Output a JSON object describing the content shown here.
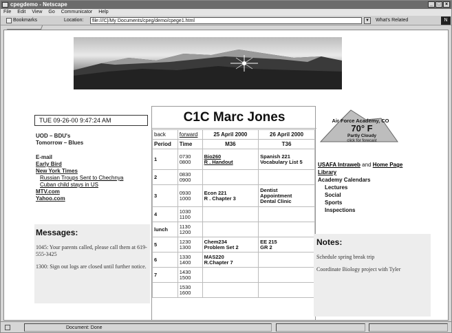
{
  "window": {
    "title": "cpegdemo - Netscape"
  },
  "menu": [
    "File",
    "Edit",
    "View",
    "Go",
    "Communicator",
    "Help"
  ],
  "toolbar": {
    "bookmarks": "Bookmarks",
    "location_label": "Location:",
    "location_value": "file:///C|/My Documents/cpeg/demo/cpege1.html",
    "related": "What's Related",
    "brand_glyph": "N"
  },
  "clock": {
    "text": "TUE   09-26-00   9:47:24 AM"
  },
  "left": {
    "uod": "UOD – BDU's",
    "tomorrow": "Tomorrow – Blues",
    "email": "E-mail",
    "links": [
      "Early Bird",
      "New York Times"
    ],
    "news": [
      "Russian Troups Sent to Chechnya",
      "Cuban child stays in US"
    ],
    "links2": [
      "MTV.com",
      "Yahoo.com"
    ]
  },
  "messages": {
    "heading": "Messages:",
    "items": [
      "1045: Your parents called, please call them at 619-555-3425",
      "1300: Sign out logs are closed until further notice."
    ]
  },
  "schedule": {
    "name": "C1C Marc Jones",
    "back": "back",
    "forward": "forward",
    "date1": "25 April 2000",
    "date2": "26 April 2000",
    "period_label": "Period",
    "time_label": "Time",
    "day1": "M36",
    "day2": "T36",
    "rows": [
      {
        "period": "1",
        "time": "0730\n0800",
        "c1": "Bio260\nR . Handout",
        "c2": "Spanish 221\nVocabulary List 5"
      },
      {
        "period": "2",
        "time": "0830\n0900",
        "c1": "",
        "c2": ""
      },
      {
        "period": "3",
        "time": "0930\n1000",
        "c1": "Econ 221\nR . Chapter 3",
        "c2": "Dentist\nAppointment\nDental Clinic"
      },
      {
        "period": "4",
        "time": "1030\n1100",
        "c1": "",
        "c2": ""
      },
      {
        "period": "lunch",
        "time": "1130\n1200",
        "c1": "",
        "c2": ""
      },
      {
        "period": "5",
        "time": "1230\n1300",
        "c1": "Chem234\nProblem Set 2",
        "c2": "EE 215\nGR 2"
      },
      {
        "period": "6",
        "time": "1330\n1400",
        "c1": "MAS220\nR.Chapter 7",
        "c2": ""
      },
      {
        "period": "7",
        "time": "1430\n1500",
        "c1": "",
        "c2": ""
      },
      {
        "period": "",
        "time": "1530\n1600",
        "c1": "",
        "c2": ""
      }
    ]
  },
  "weather": {
    "location": "Air Force Academy, CO",
    "temp": "70° F",
    "condition": "Partly Cloudy",
    "action": "click for forecast"
  },
  "right": {
    "intraweb": "USAFA Intraweb",
    "and": "and",
    "homepage": "Home Page",
    "library": "Library",
    "calendars": "Academy Calendars",
    "items": [
      "Lectures",
      "Social",
      "Sports",
      "Inspections"
    ]
  },
  "notes": {
    "heading": "Notes:",
    "items": [
      "Schedule spring break trip",
      "Coordinate Biology project with Tyler"
    ]
  },
  "status": {
    "text": "Document: Done"
  }
}
